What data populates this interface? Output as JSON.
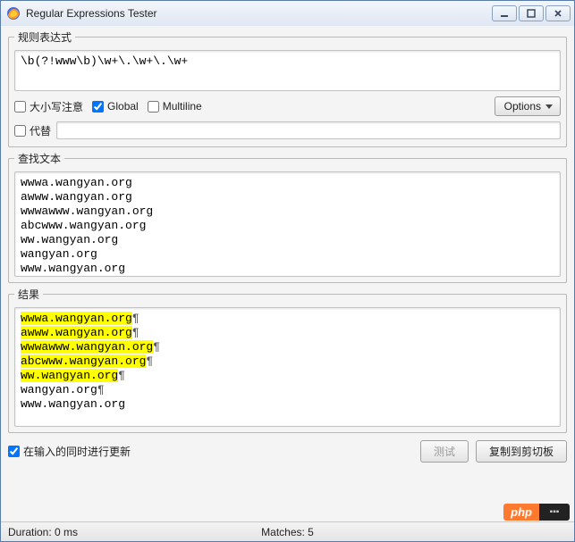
{
  "window": {
    "title": "Regular Expressions Tester"
  },
  "regex": {
    "legend": "规则表达式",
    "value": "\\b(?!www\\b)\\w+\\.\\w+\\.\\w+",
    "case_label": "大小写注意",
    "case_checked": false,
    "global_label": "Global",
    "global_checked": true,
    "multiline_label": "Multiline",
    "multiline_checked": false,
    "options_label": "Options",
    "subst_label": "代替",
    "subst_checked": false,
    "subst_value": ""
  },
  "search": {
    "legend": "查找文本",
    "lines": [
      "wwwa.wangyan.org",
      "awww.wangyan.org",
      "wwwawww.wangyan.org",
      "abcwww.wangyan.org",
      "ww.wangyan.org",
      "wangyan.org",
      "www.wangyan.org"
    ]
  },
  "result": {
    "legend": "结果",
    "items": [
      {
        "text": "wwwa.wangyan.org",
        "match": true,
        "pilcrow": true
      },
      {
        "text": "awww.wangyan.org",
        "match": true,
        "pilcrow": true
      },
      {
        "text": "wwwawww.wangyan.org",
        "match": true,
        "pilcrow": true
      },
      {
        "text": "abcwww.wangyan.org",
        "match": true,
        "pilcrow": true
      },
      {
        "text": "ww.wangyan.org",
        "match": true,
        "pilcrow": true
      },
      {
        "text": "wangyan.org",
        "match": false,
        "pilcrow": true
      },
      {
        "text": "www.wangyan.org",
        "match": false,
        "pilcrow": false
      }
    ]
  },
  "footer": {
    "auto_update_label": "在输入的同时进行更新",
    "auto_update_checked": true,
    "test_label": "测试",
    "copy_label": "复制到剪切板"
  },
  "status": {
    "duration_label": "Duration: 0 ms",
    "matches_label": "Matches: 5"
  },
  "badge": {
    "text": "php",
    "tail": "▪▪▪"
  }
}
